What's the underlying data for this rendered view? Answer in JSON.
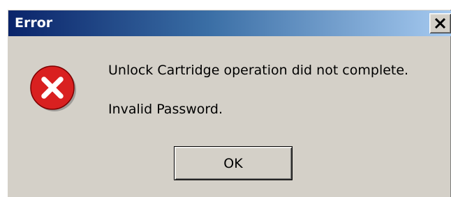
{
  "window": {
    "title": "Error",
    "close_icon": "close-icon"
  },
  "dialog": {
    "icon": "error-icon",
    "message_line1": "Unlock Cartridge operation did not complete.",
    "message_line2": "Invalid Password.",
    "ok_label": "OK"
  },
  "colors": {
    "titlebar_start": "#0a246a",
    "titlebar_end": "#a6caf0",
    "dialog_bg": "#d4d0c8",
    "error_red": "#d92020"
  }
}
